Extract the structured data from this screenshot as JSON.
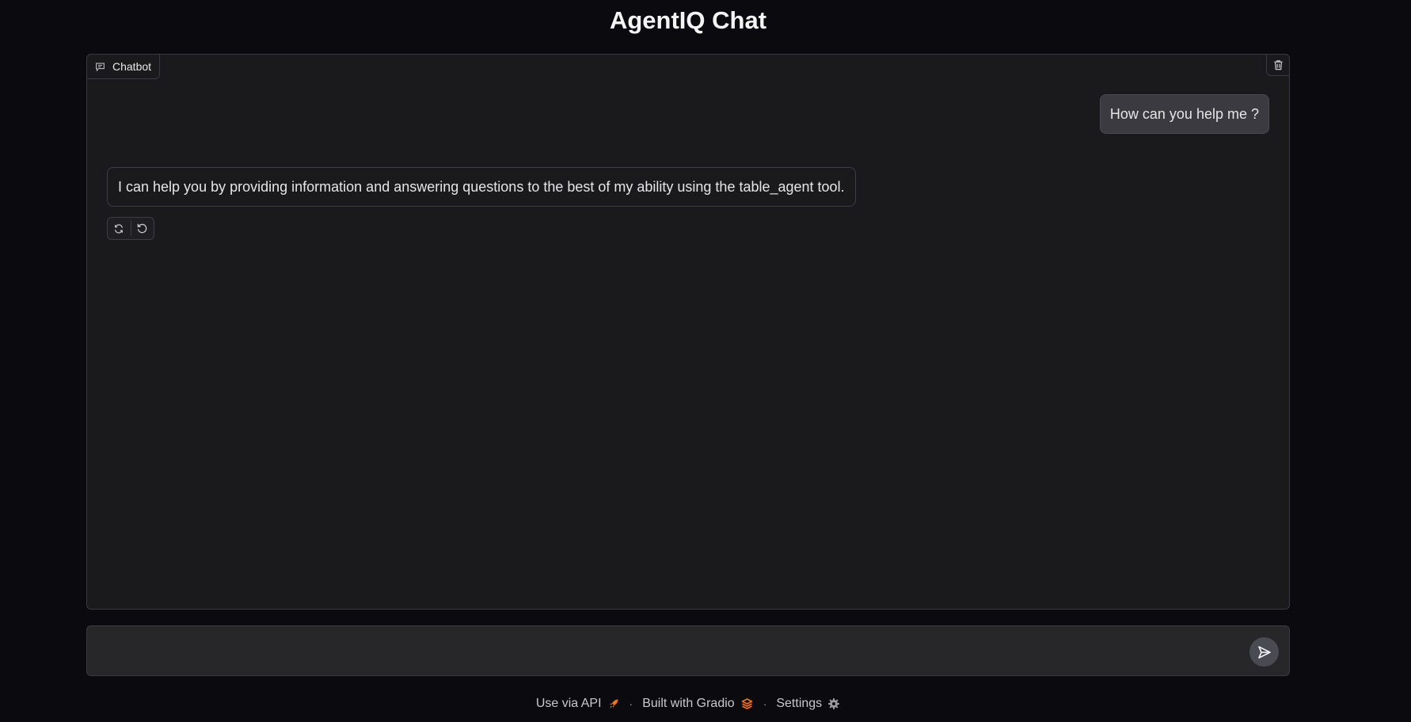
{
  "app": {
    "title": "AgentIQ Chat"
  },
  "chatbot": {
    "label": "Chatbot",
    "messages": [
      {
        "role": "user",
        "text": "How can you help me ?"
      },
      {
        "role": "assistant",
        "text": "I can help you by providing information and answering questions to the best of my ability using the table_agent tool."
      }
    ],
    "actions": [
      "retry-icon",
      "undo-icon"
    ],
    "clear_icon": "trash-icon"
  },
  "input": {
    "value": "",
    "placeholder": "",
    "send_icon": "send-icon"
  },
  "footer": {
    "api_label": "Use via API",
    "gradio_label": "Built with Gradio",
    "settings_label": "Settings",
    "separator": "·"
  },
  "colors": {
    "background": "#0b0b0f",
    "panel": "#1a1a1d",
    "user_bubble": "#3a3a40",
    "input": "#27272a",
    "accent_orange": "#f97316"
  }
}
